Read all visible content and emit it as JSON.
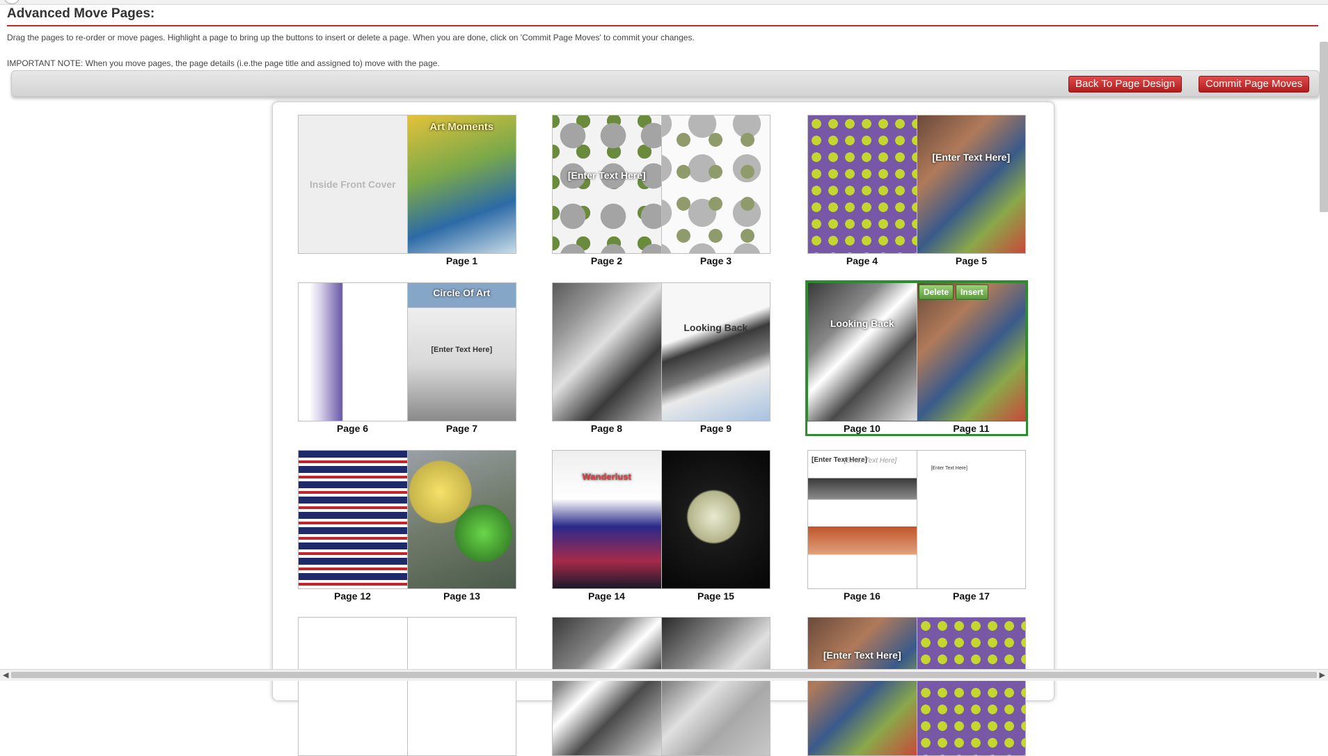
{
  "header": {
    "title": "Advanced Move Pages:",
    "instructions": "Drag the pages to re-order or move pages. Highlight a page to bring up the buttons to insert or delete a page. When you are done, click on 'Commit Page Moves' to commit your changes.",
    "note": "IMPORTANT NOTE: When you move pages, the page details (i.e.the page title and assigned to) move with the page."
  },
  "toolbar": {
    "back_label": "Back To Page Design",
    "commit_label": "Commit Page Moves"
  },
  "selection_actions": {
    "delete_label": "Delete",
    "insert_label": "Insert"
  },
  "spreads": [
    {
      "left": "",
      "right": "Page 1",
      "cover_text": "Inside Front Cover",
      "right_title": "Art Moments"
    },
    {
      "left": "Page 2",
      "right": "Page 3",
      "left_text": "[Enter Text Here]"
    },
    {
      "left": "Page 4",
      "right": "Page 5",
      "right_text": "[Enter Text Here]"
    },
    {
      "left": "Page 6",
      "right": "Page 7",
      "right_title": "Circle Of Art",
      "right_text": "[Enter Text Here]"
    },
    {
      "left": "Page 8",
      "right": "Page 9",
      "right_text": "Looking Back"
    },
    {
      "left": "Page 10",
      "right": "Page 11",
      "left_text": "Looking Back"
    },
    {
      "left": "Page 12",
      "right": "Page 13"
    },
    {
      "left": "Page 14",
      "right": "Page 15",
      "left_title": "Wanderlust"
    },
    {
      "left": "Page 16",
      "right": "Page 17",
      "left_text": "[Enter Text Here]",
      "left_title": "[Enter Text Here]",
      "right_text": "[Enter Text Here]"
    },
    {
      "left": "",
      "right": ""
    },
    {
      "left": "",
      "right": ""
    },
    {
      "left": "",
      "right": "",
      "left_text": "[Enter Text Here]"
    }
  ],
  "colors": {
    "accent_red": "#c0272d",
    "selection_green": "#2e8b2e"
  }
}
